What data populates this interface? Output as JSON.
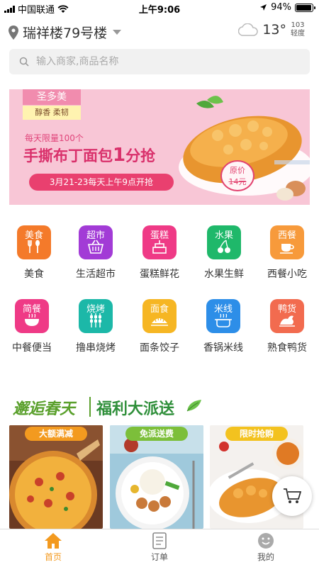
{
  "status_bar": {
    "carrier": "中国联通",
    "time": "上午9:06",
    "battery": "94%",
    "battery_level": 0.94
  },
  "header": {
    "location": "瑞祥楼79号楼",
    "temperature": "13°",
    "aqi_value": "103",
    "aqi_label": "轻度"
  },
  "search": {
    "placeholder": "输入商家,商品名称"
  },
  "banner": {
    "tag_brand": "圣多美",
    "tag_slogan": "醇香 柔韧",
    "limit_text": "每天限量100个",
    "title_a": "手撕布丁面包",
    "title_num": "1",
    "title_b": "分抢",
    "date_text": "3月21-23每天上午9点开抢",
    "price_label": "原价",
    "price_old": "14元"
  },
  "categories": [
    {
      "icon_text": "美食",
      "label": "美食",
      "icon": "fork-spoon-icon",
      "color": "#f47a2a"
    },
    {
      "icon_text": "超市",
      "label": "生活超市",
      "icon": "basket-icon",
      "color": "#a23bd6"
    },
    {
      "icon_text": "蛋糕",
      "label": "蛋糕鲜花",
      "icon": "cake-icon",
      "color": "#ef3a86"
    },
    {
      "icon_text": "水果",
      "label": "水果生鲜",
      "icon": "cherry-icon",
      "color": "#1fb86a"
    },
    {
      "icon_text": "西餐",
      "label": "西餐小吃",
      "icon": "cup-icon",
      "color": "#f79a3b"
    },
    {
      "icon_text": "简餐",
      "label": "中餐便当",
      "icon": "bowl-icon",
      "color": "#ef3a86"
    },
    {
      "icon_text": "烧烤",
      "label": "撸串烧烤",
      "icon": "skewer-icon",
      "color": "#1cb8a8"
    },
    {
      "icon_text": "面食",
      "label": "面条饺子",
      "icon": "dumpling-icon",
      "color": "#f6b623"
    },
    {
      "icon_text": "米线",
      "label": "香锅米线",
      "icon": "pot-icon",
      "color": "#2d8ee8"
    },
    {
      "icon_text": "鸭货",
      "label": "熟食鸭货",
      "icon": "duck-icon",
      "color": "#f26b4f"
    }
  ],
  "promo": {
    "title_a": "邂逅春天",
    "title_b": "福利大派送",
    "cards": [
      {
        "label": "大额满减",
        "label_color": "#f39a1f"
      },
      {
        "label": "免派送费",
        "label_color": "#7cbf3a"
      },
      {
        "label": "限时抢购",
        "label_color": "#f3c21f"
      }
    ]
  },
  "tabbar": {
    "home": "首页",
    "orders": "订单",
    "mine": "我的"
  },
  "colors": {
    "accent": "#f39a1f"
  }
}
